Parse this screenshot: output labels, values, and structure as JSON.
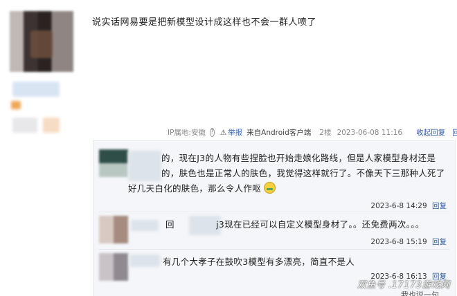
{
  "post": {
    "text": "说实话网易要是把新模型设计成这样也不会一群人喷了",
    "meta": {
      "ip": "IP属地:安徽",
      "help_icon": "?",
      "report": "举报",
      "device": "来自Android客户端",
      "floor": "2楼",
      "time": "2023-06-08 11:16",
      "collapse_replies": "收起回复"
    }
  },
  "replies": [
    {
      "lines": [
        "的，现在J3的人物有些捏脸也开始走娘化路线，但是人家模型身材还是",
        "的，肤色也是正常人的肤色，我觉得这样就行了。不像天下三那种人死了",
        "好几天白化的肤色，那么令人作呕"
      ],
      "time": "2023-6-8 14:29",
      "reply_label": "回复"
    },
    {
      "prefix": "回",
      "text": "j3现在已经可以自定义模型身材了。。还免费两次。。。",
      "time": "2023-6-8 15:19",
      "reply_label": "回复"
    },
    {
      "text": "有几个大孝子在鼓吹3模型有多漂亮，简直不是人",
      "time": "2023-6-8 16:13",
      "reply_label": "回复"
    }
  ],
  "watermark": "双鱼号 .17173游戏网",
  "bottom_cut": "我也说一句",
  "colors": {
    "link": "#2e5aa8",
    "reply_bg": "#f5f6f9",
    "meta": "#888888"
  }
}
